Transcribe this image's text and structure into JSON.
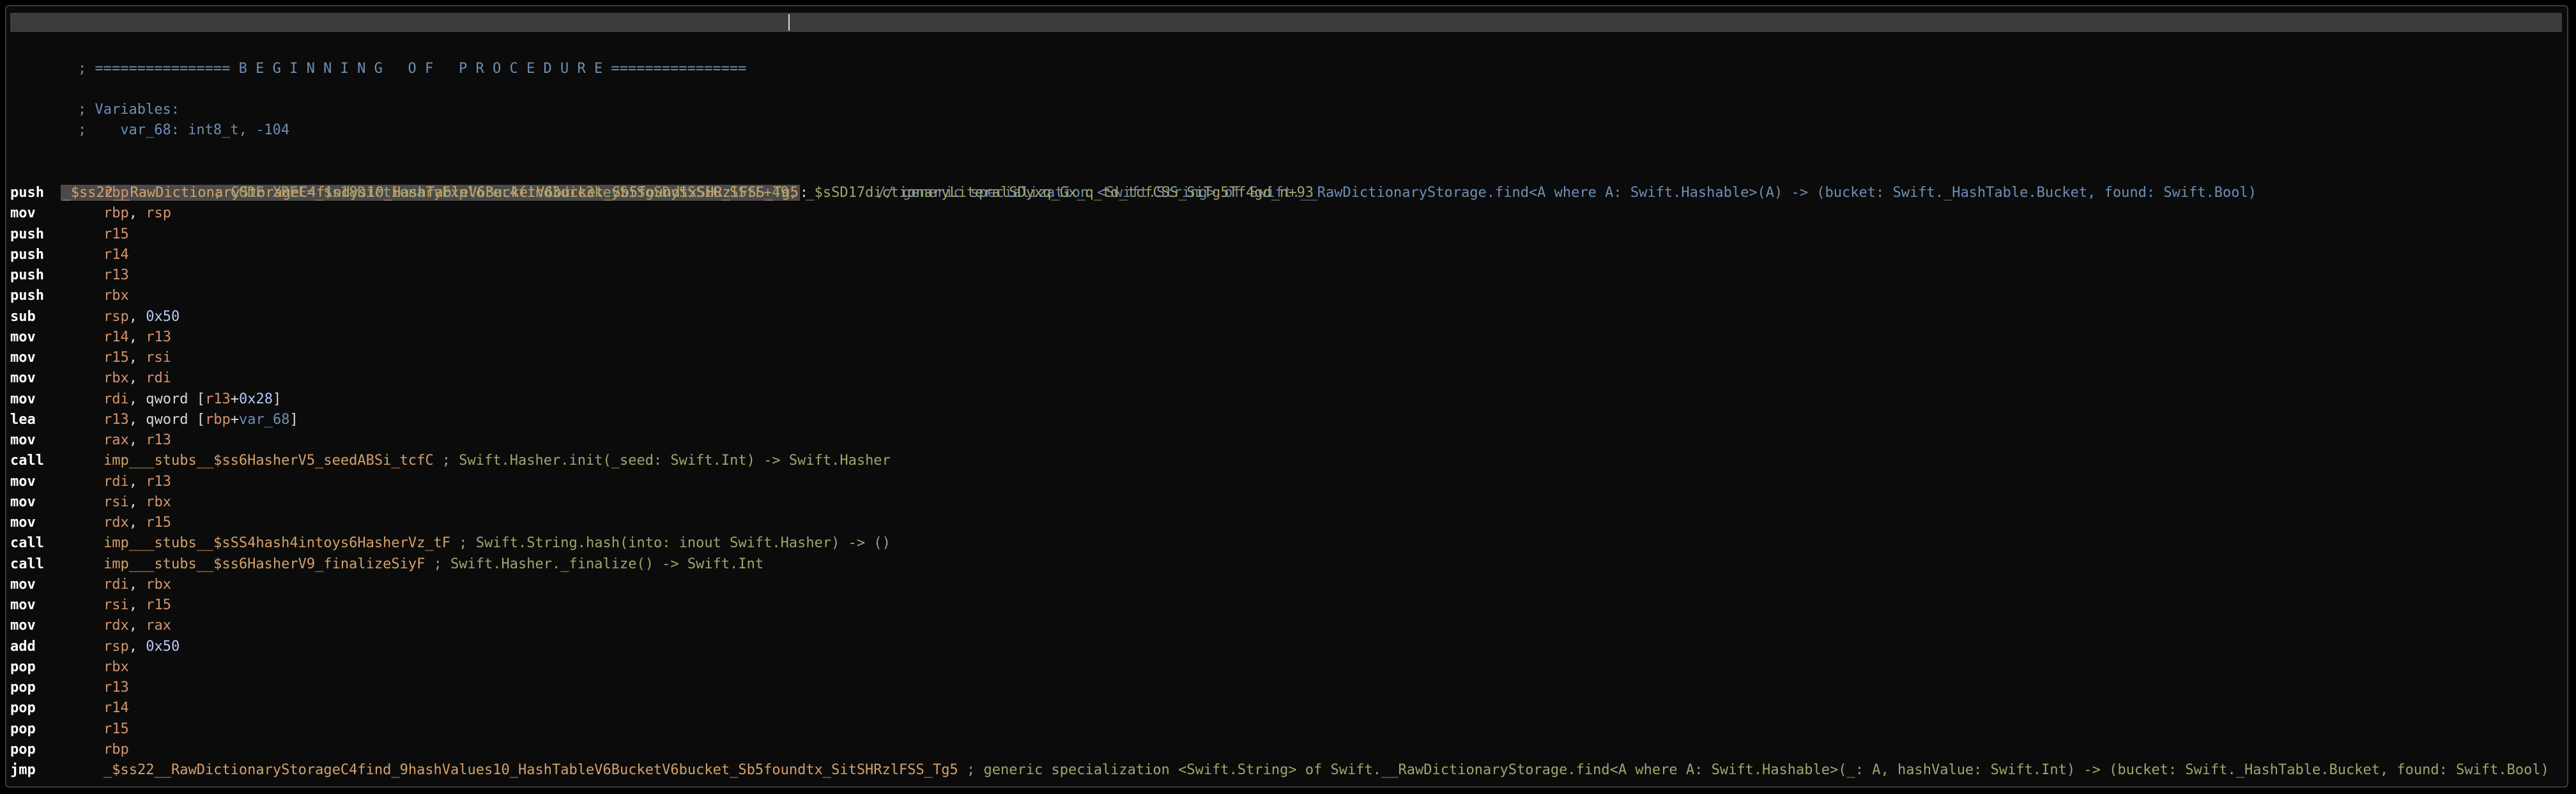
{
  "header": {
    "banner": "; ================ B E G I N N I N G   O F   P R O C E D U R E ================",
    "variables_label": "; Variables:",
    "variable_line": ";    var_68: int8_t, -104"
  },
  "procedure": {
    "label": "_$ss22__RawDictionaryStorageC4findys10_HashTableV6BucketV6bucket_Sb5foundtxSHRzlFSS_Tg5",
    "label_colon": ":",
    "label_comment": "// generic specialization <Swift.String> of Swift.__RawDictionaryStorage.find<A where A: Swift.Hashable>(A) -> (bucket: Swift._HashTable.Bucket, found: Swift.Bool)"
  },
  "instructions": [
    {
      "mnemonic": "push",
      "parts": [
        {
          "t": "rbp",
          "c": "reg"
        },
        {
          "t": "          ; CODE XREF=_$s18DictionaryExplorer4find3dic3keySiSgSDySSSiG_SStF+49, _$sSD17dictionaryLiteralSDyxq_Gx_q_td_tcfCSS_SiTg5Tf4gd_n+93",
          "c": "xref"
        }
      ]
    },
    {
      "mnemonic": "mov",
      "parts": [
        {
          "t": "rbp",
          "c": "reg"
        },
        {
          "t": ", ",
          "c": "kw"
        },
        {
          "t": "rsp",
          "c": "reg"
        }
      ]
    },
    {
      "mnemonic": "push",
      "parts": [
        {
          "t": "r15",
          "c": "reg"
        }
      ]
    },
    {
      "mnemonic": "push",
      "parts": [
        {
          "t": "r14",
          "c": "reg"
        }
      ]
    },
    {
      "mnemonic": "push",
      "parts": [
        {
          "t": "r13",
          "c": "reg"
        }
      ]
    },
    {
      "mnemonic": "push",
      "parts": [
        {
          "t": "rbx",
          "c": "reg"
        }
      ]
    },
    {
      "mnemonic": "sub",
      "parts": [
        {
          "t": "rsp",
          "c": "reg"
        },
        {
          "t": ", ",
          "c": "kw"
        },
        {
          "t": "0x50",
          "c": "num"
        }
      ]
    },
    {
      "mnemonic": "mov",
      "parts": [
        {
          "t": "r14",
          "c": "reg"
        },
        {
          "t": ", ",
          "c": "kw"
        },
        {
          "t": "r13",
          "c": "reg"
        }
      ]
    },
    {
      "mnemonic": "mov",
      "parts": [
        {
          "t": "r15",
          "c": "reg"
        },
        {
          "t": ", ",
          "c": "kw"
        },
        {
          "t": "rsi",
          "c": "reg"
        }
      ]
    },
    {
      "mnemonic": "mov",
      "parts": [
        {
          "t": "rbx",
          "c": "reg"
        },
        {
          "t": ", ",
          "c": "kw"
        },
        {
          "t": "rdi",
          "c": "reg"
        }
      ]
    },
    {
      "mnemonic": "mov",
      "parts": [
        {
          "t": "rdi",
          "c": "reg"
        },
        {
          "t": ", qword [",
          "c": "kw"
        },
        {
          "t": "r13",
          "c": "reg"
        },
        {
          "t": "+",
          "c": "kw"
        },
        {
          "t": "0x28",
          "c": "num"
        },
        {
          "t": "]",
          "c": "kw"
        }
      ]
    },
    {
      "mnemonic": "lea",
      "parts": [
        {
          "t": "r13",
          "c": "reg"
        },
        {
          "t": ", qword [",
          "c": "kw"
        },
        {
          "t": "rbp",
          "c": "reg"
        },
        {
          "t": "+",
          "c": "kw"
        },
        {
          "t": "var_68",
          "c": "blue-var"
        },
        {
          "t": "]",
          "c": "kw"
        }
      ]
    },
    {
      "mnemonic": "mov",
      "parts": [
        {
          "t": "rax",
          "c": "reg"
        },
        {
          "t": ", ",
          "c": "kw"
        },
        {
          "t": "r13",
          "c": "reg"
        }
      ]
    },
    {
      "mnemonic": "call",
      "parts": [
        {
          "t": "imp___stubs__$ss6HasherV5_seedABSi_tcfC",
          "c": "sym"
        },
        {
          "t": " ; Swift.Hasher.init(_seed: Swift.Int) -> Swift.Hasher",
          "c": "comment"
        }
      ]
    },
    {
      "mnemonic": "mov",
      "parts": [
        {
          "t": "rdi",
          "c": "reg"
        },
        {
          "t": ", ",
          "c": "kw"
        },
        {
          "t": "r13",
          "c": "reg"
        }
      ]
    },
    {
      "mnemonic": "mov",
      "parts": [
        {
          "t": "rsi",
          "c": "reg"
        },
        {
          "t": ", ",
          "c": "kw"
        },
        {
          "t": "rbx",
          "c": "reg"
        }
      ]
    },
    {
      "mnemonic": "mov",
      "parts": [
        {
          "t": "rdx",
          "c": "reg"
        },
        {
          "t": ", ",
          "c": "kw"
        },
        {
          "t": "r15",
          "c": "reg"
        }
      ]
    },
    {
      "mnemonic": "call",
      "parts": [
        {
          "t": "imp___stubs__$sSS4hash4intoys6HasherVz_tF",
          "c": "sym"
        },
        {
          "t": " ; Swift.String.hash(into: inout Swift.Hasher) -> ()",
          "c": "comment"
        }
      ]
    },
    {
      "mnemonic": "call",
      "parts": [
        {
          "t": "imp___stubs__$ss6HasherV9_finalizeSiyF",
          "c": "sym"
        },
        {
          "t": " ; Swift.Hasher._finalize() -> Swift.Int",
          "c": "comment"
        }
      ]
    },
    {
      "mnemonic": "mov",
      "parts": [
        {
          "t": "rdi",
          "c": "reg"
        },
        {
          "t": ", ",
          "c": "kw"
        },
        {
          "t": "rbx",
          "c": "reg"
        }
      ]
    },
    {
      "mnemonic": "mov",
      "parts": [
        {
          "t": "rsi",
          "c": "reg"
        },
        {
          "t": ", ",
          "c": "kw"
        },
        {
          "t": "r15",
          "c": "reg"
        }
      ]
    },
    {
      "mnemonic": "mov",
      "parts": [
        {
          "t": "rdx",
          "c": "reg"
        },
        {
          "t": ", ",
          "c": "kw"
        },
        {
          "t": "rax",
          "c": "reg"
        }
      ]
    },
    {
      "mnemonic": "add",
      "parts": [
        {
          "t": "rsp",
          "c": "reg"
        },
        {
          "t": ", ",
          "c": "kw"
        },
        {
          "t": "0x50",
          "c": "num"
        }
      ]
    },
    {
      "mnemonic": "pop",
      "parts": [
        {
          "t": "rbx",
          "c": "reg"
        }
      ]
    },
    {
      "mnemonic": "pop",
      "parts": [
        {
          "t": "r13",
          "c": "reg"
        }
      ]
    },
    {
      "mnemonic": "pop",
      "parts": [
        {
          "t": "r14",
          "c": "reg"
        }
      ]
    },
    {
      "mnemonic": "pop",
      "parts": [
        {
          "t": "r15",
          "c": "reg"
        }
      ]
    },
    {
      "mnemonic": "pop",
      "parts": [
        {
          "t": "rbp",
          "c": "reg"
        }
      ]
    },
    {
      "mnemonic": "jmp",
      "parts": [
        {
          "t": "_$ss22__RawDictionaryStorageC4find_9hashValues10_HashTableV6BucketV6bucket_Sb5foundtx_SitSHRzlFSS_Tg5",
          "c": "sym"
        },
        {
          "t": " ; generic specialization <Swift.String> of Swift.__RawDictionaryStorage.find<A where A: Swift.Hashable>(_: A, hashValue: Swift.Int) -> (bucket: Swift._HashTable.Bucket, found: Swift.Bool)",
          "c": "comment"
        }
      ]
    }
  ]
}
